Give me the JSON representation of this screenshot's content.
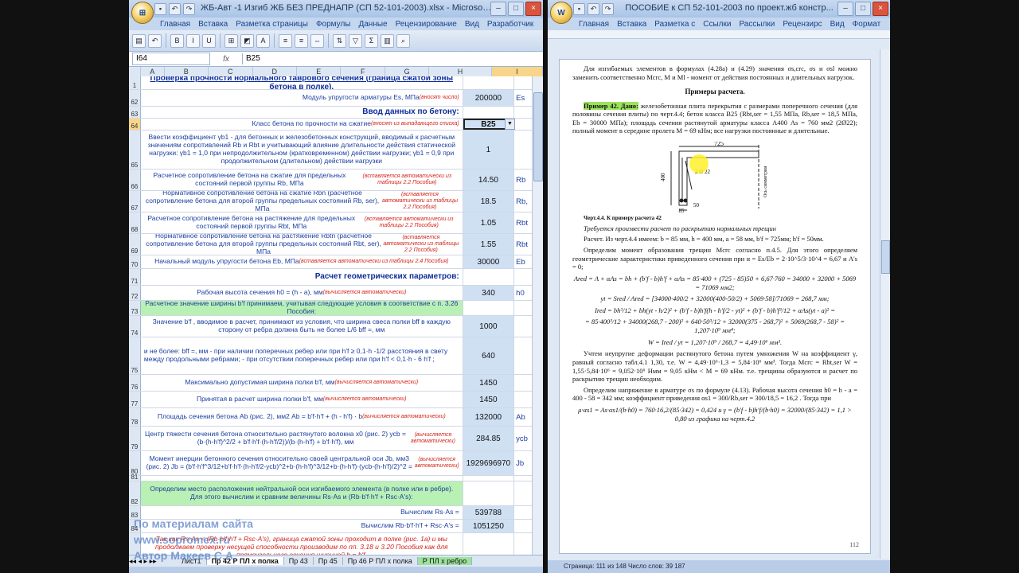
{
  "excel": {
    "title": "ЖБ-Авт -1 Изгиб ЖБ БЕЗ ПРЕДНАПР (СП 52-101-2003).xlsx - Microsoft Excel",
    "tabs": [
      "Главная",
      "Вставка",
      "Разметка страницы",
      "Формулы",
      "Данные",
      "Рецензирование",
      "Вид",
      "Разработчик"
    ],
    "name_box": "I64",
    "fx": "fx",
    "formula": "B25",
    "columns": [
      "A",
      "B",
      "C",
      "D",
      "E",
      "F",
      "G",
      "H",
      "I"
    ],
    "selected_column": "I",
    "rows": [
      {
        "n": "1",
        "text": "Проверка прочности нормального таврового сечения  (граница сжатой зоны бетона в полке).",
        "type": "title",
        "h": 16
      },
      {
        "n": "62",
        "text": "Модуль упругости арматуры Es, МПа",
        "hint": "(вносят число)",
        "value": "200000",
        "unit": "Es",
        "type": "right",
        "h": 20
      },
      {
        "n": "63",
        "text": "Ввод данных по бетону:",
        "type": "sect",
        "h": 14
      },
      {
        "n": "64",
        "text": "Класс бетона по прочности на сжатие",
        "hint": "(вносят из выпадающего списка)",
        "value": "B25",
        "type": "right",
        "sel": true,
        "h": 14
      },
      {
        "n": "65",
        "text": "Ввести коэффициент γb1 - для бетонных и железобетонных конструкций, вводимый к расчетным значениям сопротивлений Rb и Rbt и учитывающий влияние длительности действия статической нагрузки: γb1 = 1,0 при непродолжительном (кратковременном) действии нагрузки; γb1 = 0,9 при продолжительном (длительном) действии нагрузки",
        "value": "1",
        "type": "normal",
        "h": 48
      },
      {
        "n": "66",
        "text": "Расчетное сопротивление бетона на сжатие для предельных состояний первой группы Rb, МПа",
        "hint": "(вставляется автоматически из таблицы 2.2 Пособия)",
        "value": "14.50",
        "unit": "Rb",
        "type": "normal",
        "h": 26
      },
      {
        "n": "67",
        "text": "Нормативное сопротивление бетона на сжатие Rbn (расчетное сопротивление бетона для второй группы предельных состояний Rb, ser), МПа",
        "hint": "(вставляется автоматически из таблицы 2.2 Пособия)",
        "value": "18.5",
        "unit": "Rb,",
        "type": "normal",
        "h": 26
      },
      {
        "n": "68",
        "text": "Расчетное сопротивление бетона на растяжение  для предельных состояний первой группы Rbt, МПа",
        "hint": "(вставляется автоматически из таблицы 2.2 Пособия)",
        "value": "1.05",
        "unit": "Rbt",
        "type": "normal",
        "h": 26
      },
      {
        "n": "69",
        "text": "Нормативное сопротивление бетона на растяжение Rbtn  (расчетное сопротивление бетона для второй группы предельных состояний Rbt, ser), МПа",
        "hint": "(вставляется автоматически из таблицы 2.2 Пособия)",
        "value": "1.55",
        "unit": "Rbt",
        "type": "normal",
        "h": 26
      },
      {
        "n": "70",
        "text": "Начальный модуль упругости бетона Eb, МПа",
        "hint": "(вставляется автоматически из таблицы 2.4 Пособия)",
        "value": "30000",
        "unit": "Eb",
        "type": "normal",
        "h": 16
      },
      {
        "n": "71",
        "text": "Расчет геометрических параметров:",
        "type": "sect",
        "h": 20
      },
      {
        "n": "72",
        "text": "Рабочая высота сечения h0 = (h - a), мм",
        "hint": "(вычисляется автоматически)",
        "value": "340",
        "unit": "h0",
        "type": "normal",
        "h": 18
      },
      {
        "n": "73",
        "text": "Расчетное значение ширины b'f принимаем, учитывая следующие условия в соответствие с п. 3.26 Пособия:",
        "type": "green",
        "h": 18
      },
      {
        "n": "74",
        "text": "Значение b'f , вводимое в расчет, принимают из условия, что ширина свеса полки bff в каждую сторону от ребра должна быть не более L/6     bff   =, мм",
        "value": "1000",
        "type": "normal",
        "h": 26
      },
      {
        "n": "75",
        "text": "и не более:                                                                                        bff  =, мм - при наличии поперечных ребер или при h'f ≥ 0,1·h      -1/2 расстояния в свету между продольными ребрами; - при отсутствии поперечных ребер или при h'f < 0,1·h      - 6 h'f ;",
        "value": "640",
        "type": "left",
        "h": 46
      },
      {
        "n": "76",
        "text": "Максимально допустимая ширина полки b'f, мм",
        "hint": "(вычисляется автоматически)",
        "value": "1450",
        "type": "normal",
        "h": 20
      },
      {
        "n": "77",
        "text": "Принятая в расчет ширина полки b'f, мм",
        "hint": "(вычисляется автоматически)",
        "value": "1450",
        "type": "normal",
        "h": 20
      },
      {
        "n": "78",
        "text": "Площадь сечения бетона Ab (рис. 2), мм2   Ab = b'f·h'f + (h - h'f) · b",
        "hint": "(вычисляется автоматически)",
        "value": "132000",
        "unit": "Ab",
        "type": "normal",
        "h": 22
      },
      {
        "n": "79",
        "text": "Центр тяжести сечения бетона относительно растянутого волокна x0 (рис. 2) ycb = (b·(h-h'f)^2/2 + b'f·h'f·(h-h'f/2))/(b·(h-h'f) + b'f·h'f), мм",
        "hint": "(вычисляется автоматически)",
        "value": "284.85",
        "unit": "ycb",
        "type": "normal",
        "h": 30
      },
      {
        "n": "80",
        "text": "Момент инерции бетонного сечения относительно своей центральной оси Jb, мм3 (рис. 2) Jb = (b'f·h'f^3/12+b'f·h'f·(h-h'f/2-ycb)^2+b·(h-h'f)^3/12+b·(h-h'f)·(ycb-(h-h'f)/2)^2 =",
        "hint": "(вычисляется автоматически)",
        "value": "1929696970",
        "unit": "Jb",
        "type": "normal",
        "h": 30
      },
      {
        "n": "81",
        "text": "",
        "type": "normal",
        "h": 6
      },
      {
        "n": "82",
        "text": "Определим место расположения нейтральной оси изгибаемого элемента (в полке или в ребре). Для этого вычислим и сравним величины Rs·As   и  (Rb·b'f·h'f + Rsc·A's):",
        "type": "green",
        "h": 30
      },
      {
        "n": "83",
        "text": "Вычислим Rs·As =",
        "value": "539788",
        "type": "right",
        "h": 16
      },
      {
        "n": "84",
        "text": "Вычислим Rb·b'f·h'f + Rsc·A's =",
        "value": "1051250",
        "type": "right",
        "h": 16
      },
      {
        "n": "85",
        "text": "Так как Rs·As < (Rb·b'f·h'f + Rsc·A's), граница сжатой зоны проходит в полке (рис. 1а) и мы продолжаем проверку несущей способности производим по пп. 3.18 и 3.20 Пособия как для прямоугольного сечения шириной b = b'f.",
        "type": "red",
        "h": 36
      }
    ],
    "sheet_tabs": [
      "Лист1",
      "Пр 42 Р ПЛ х полка",
      "Пр 43",
      "Пр 45",
      "Пр 46 Р ПЛ х полка",
      "Р ПЛ х ребро"
    ],
    "active_sheet": "Пр 42 Р ПЛ х полка"
  },
  "word": {
    "title": "ПОСОБИЕ к СП 52-101-2003 по проект.жб констр...",
    "tabs": [
      "Главная",
      "Вставка",
      "Разметка с",
      "Ссылки",
      "Рассылки",
      "Рецензирс",
      "Вид",
      "Формат"
    ],
    "intro": "Для изгибаемых элементов в формулах (4.28а) и (4.29) значения σs,crc, σs и σsl можно заменить соответственно Mcrc, M и Ml - момент от действия постоянных и длительных нагрузок.",
    "heading": "Примеры расчета.",
    "example_label": "Пример 42. Дано:",
    "example_text": "железобетонная плита перекрытия с размерами поперечного сечения (для половины сечения плиты) по черт.4.4; бетон класса B25 (Rbt,ser = 1,55 МПа, Rb,ser = 18,5 МПа, Eb = 30000 МПа); площадь сечения растянутой арматуры класса А400 As = 760 мм2 (2Ø22); полный момент в середине пролета M = 69 кНм; все нагрузки постоянные и длительные.",
    "fig_dims": [
      "725",
      "400",
      "85",
      "50",
      "2 Ø 22",
      "Ось симметрии"
    ],
    "fig_caption": "Черт.4.4. К примеру расчета 42",
    "req": "Требуется произвести расчет по раскрытию нормальных трещин",
    "calc1": "Расчет. Из черт.4.4 имеем: b = 85 мм, h = 400 мм, a = 58 мм, b'f = 725мм; h'f = 50мм.",
    "calc2": "Определим момент образования трещин Mcrc согласно п.4.5. Для этого определяем геометрические характеристики приведенного сечения при   α = Es/Eb = 2·10^5/3·10^4 = 6,67  и A's = 0;",
    "calc3": "Ared = A + αAs = bh + (b'f - b)h'f + αAs = 85·400 + (725 - 85)50 + 6,67·760 = 34000 + 32000 + 5069 = 71069 мм2;",
    "calc4": "yt = Sred / Ared = [34000·400/2 + 32000(400-50/2) + 5069·58]/71069 = 268,7 мм;",
    "calc5": "Ired = bh³/12 + bh(yt - h/2)² + (b'f - b)h'f(h - h'f/2 - yt)² + (b'f - b)h'f³/12 + αAs(yt - a)² =",
    "calc6": "= 85·400³/12 + 34000(268,7 - 200)² + 640·50³/12 + 32000(375 - 268,7)² + 5069(268,7 - 58)² = 1,207·10⁹ мм⁴;",
    "calc7": "W = Ired / yt = 1,207·10⁹ / 268,7 = 4,49·10⁶ мм³.",
    "calc8": "Учтем неупругие деформации растянутого бетона путем умножения W на коэффициент γ, равный согласно табл.4.1 1,30, т.е. W = 4,49·10⁶·1,3 = 5,84·10⁶ мм³. Тогда Mcrc = Rbt,ser W = 1,55·5,84·10⁶ = 9,052·10⁶ Нмм = 9,05 кНм < M = 69 кНм. т.е. трещины образуются и расчет по раскрытию трещин необходим.",
    "calc9": "Определим напряжение в арматуре σs по формуле (4.13). Рабочая высота сечения h0 = h - a = 400 - 58 = 342 мм; коэффициент приведения  αs1 = 300/Rb,ser = 300/18,5 = 16,2 . Тогда при",
    "calc10": "μ·αs1 = As·αs1/(b·h0) = 760·16,2/(85·342) = 0,424   и   γ = (b'f - b)h'f/(b·h0) = 32000/(85·342) = 1,1 > 0,80   из графика на черт.4.2",
    "page_number": "112",
    "status": "Страница: 111 из 148    Число слов: 39 187"
  },
  "watermark": {
    "line1": "По материалам сайта",
    "line2": "www.sopromex.ru",
    "line3": "Автор Макеев С.А."
  }
}
